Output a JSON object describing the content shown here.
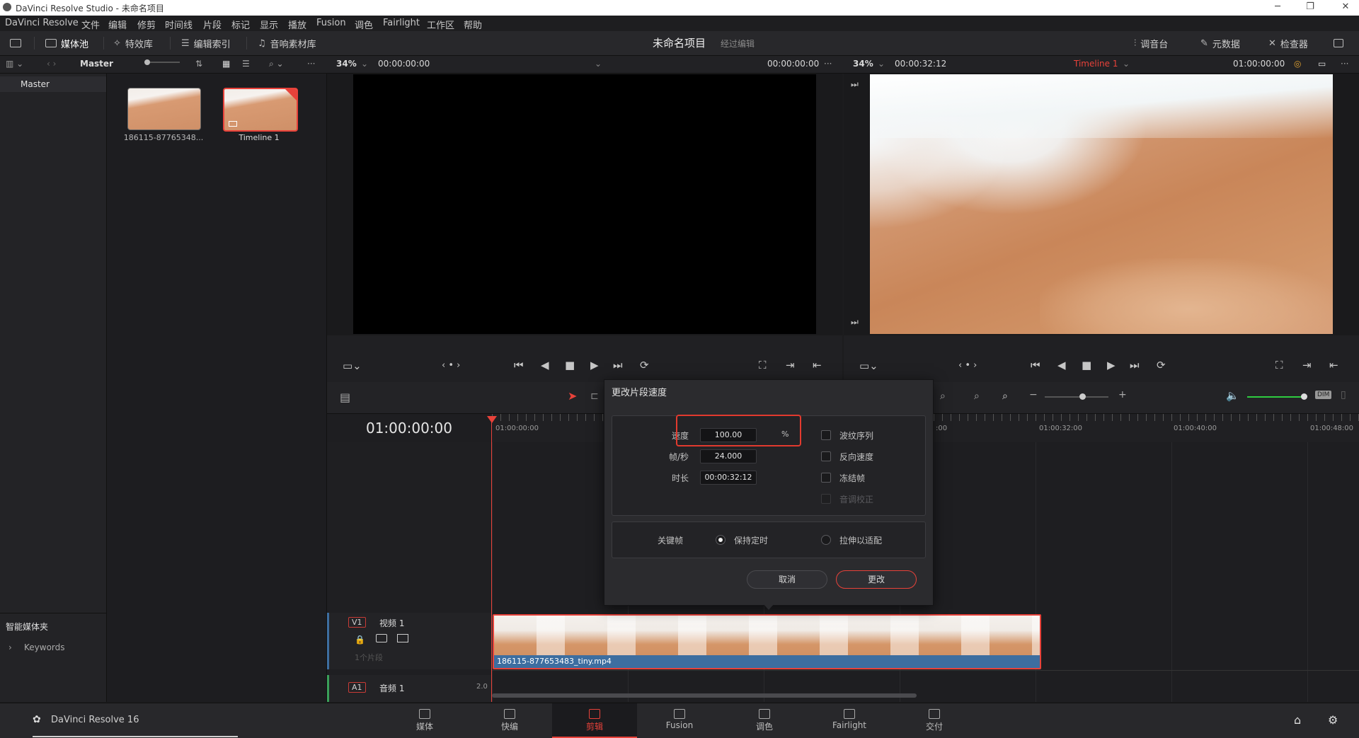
{
  "window": {
    "title": "DaVinci Resolve Studio - 未命名项目"
  },
  "menubar": {
    "items": [
      "DaVinci Resolve",
      "文件",
      "编辑",
      "修剪",
      "时间线",
      "片段",
      "标记",
      "显示",
      "播放",
      "Fusion",
      "调色",
      "Fairlight",
      "工作区",
      "帮助"
    ]
  },
  "toolbar": {
    "media_pool": "媒体池",
    "effects": "特效库",
    "edit_index": "编辑索引",
    "sound_library": "音响素材库",
    "project_name": "未命名项目",
    "project_status": "经过编辑",
    "mixer": "调音台",
    "metadata": "元数据",
    "inspector": "检查器"
  },
  "subbar": {
    "bin_name": "Master",
    "source_zoom": "34%",
    "source_tc_left": "00:00:00:00",
    "source_tc_right": "00:00:00:00",
    "record_zoom": "34%",
    "record_duration": "00:00:32:12",
    "timeline_name": "Timeline 1",
    "record_tc": "01:00:00:00"
  },
  "bins": {
    "master": "Master",
    "smart_bins": "智能媒体夹",
    "keywords": "Keywords"
  },
  "media_pool": {
    "clips": [
      {
        "name": "186115-87765348..."
      },
      {
        "name": "Timeline 1"
      }
    ]
  },
  "timeline": {
    "timecode": "01:00:00:00",
    "ruler": [
      "01:00:00:00",
      ":00",
      "01:00:32:00",
      "01:00:40:00",
      "01:00:48:00"
    ],
    "video_track": {
      "tag": "V1",
      "name": "视频 1",
      "clips_count": "1个片段"
    },
    "audio_track": {
      "tag": "A1",
      "name": "音频 1",
      "level": "2.0"
    },
    "clip_name": "186115-877653483_tiny.mp4"
  },
  "dialog": {
    "title": "更改片段速度",
    "speed_label": "速度",
    "speed_value": "100.00",
    "speed_unit": "%",
    "fps_label": "帧/秒",
    "fps_value": "24.000",
    "duration_label": "时长",
    "duration_value": "00:00:32:12",
    "ripple_sequence": "波纹序列",
    "reverse_speed": "反向速度",
    "freeze_frame": "冻结帧",
    "pitch_correction": "音调校正",
    "keyframes_label": "关键帧",
    "keep_timing": "保持定时",
    "stretch_to_fit": "拉伸以适配",
    "cancel": "取消",
    "change": "更改"
  },
  "bottombar": {
    "app_name": "DaVinci Resolve 16",
    "pages": [
      "媒体",
      "快编",
      "剪辑",
      "Fusion",
      "调色",
      "Fairlight",
      "交付"
    ],
    "active_page": "剪辑"
  },
  "colors": {
    "accent": "#e8423a",
    "clip_label": "#3d6ea0",
    "panel": "#28282b"
  }
}
